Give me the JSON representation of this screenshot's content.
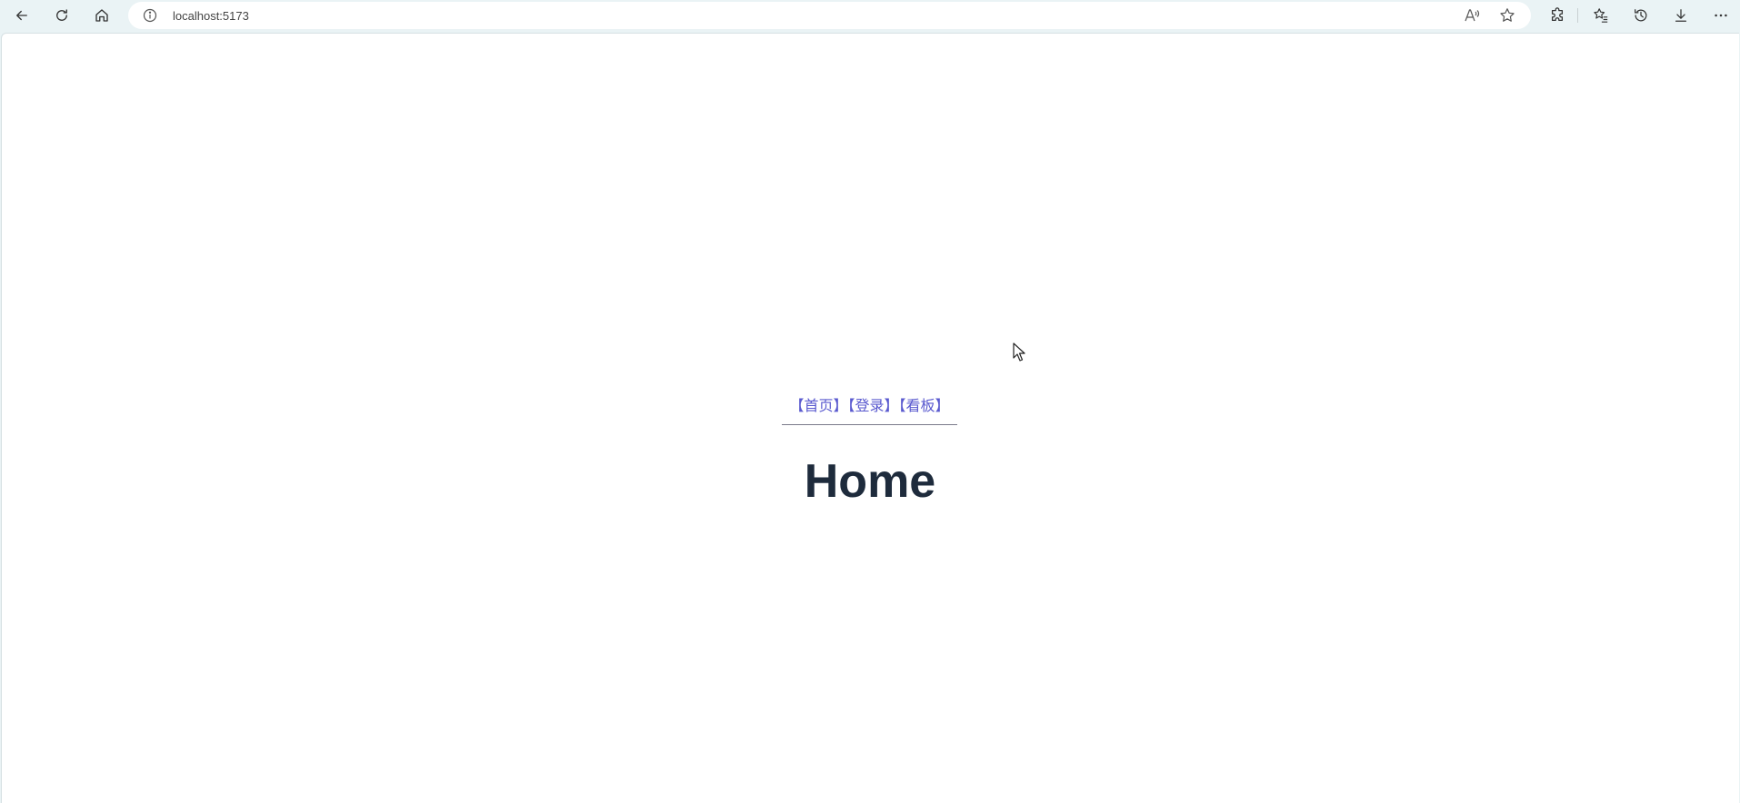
{
  "browser": {
    "url": "localhost:5173",
    "icons": {
      "back": "back-arrow-icon",
      "refresh": "refresh-icon",
      "home": "home-icon",
      "info": "info-icon",
      "read_aloud": "read-aloud-icon",
      "favorite": "star-icon",
      "extensions": "extensions-icon",
      "favorites": "favorites-icon",
      "history": "history-icon",
      "downloads": "download-icon",
      "more": "more-icon"
    }
  },
  "nav": {
    "links": [
      {
        "label": "【首页】"
      },
      {
        "label": "【登录】"
      },
      {
        "label": "【看板】"
      }
    ],
    "link_color": "#5a5acf"
  },
  "page": {
    "title": "Home",
    "title_color": "#1e2b3c"
  }
}
